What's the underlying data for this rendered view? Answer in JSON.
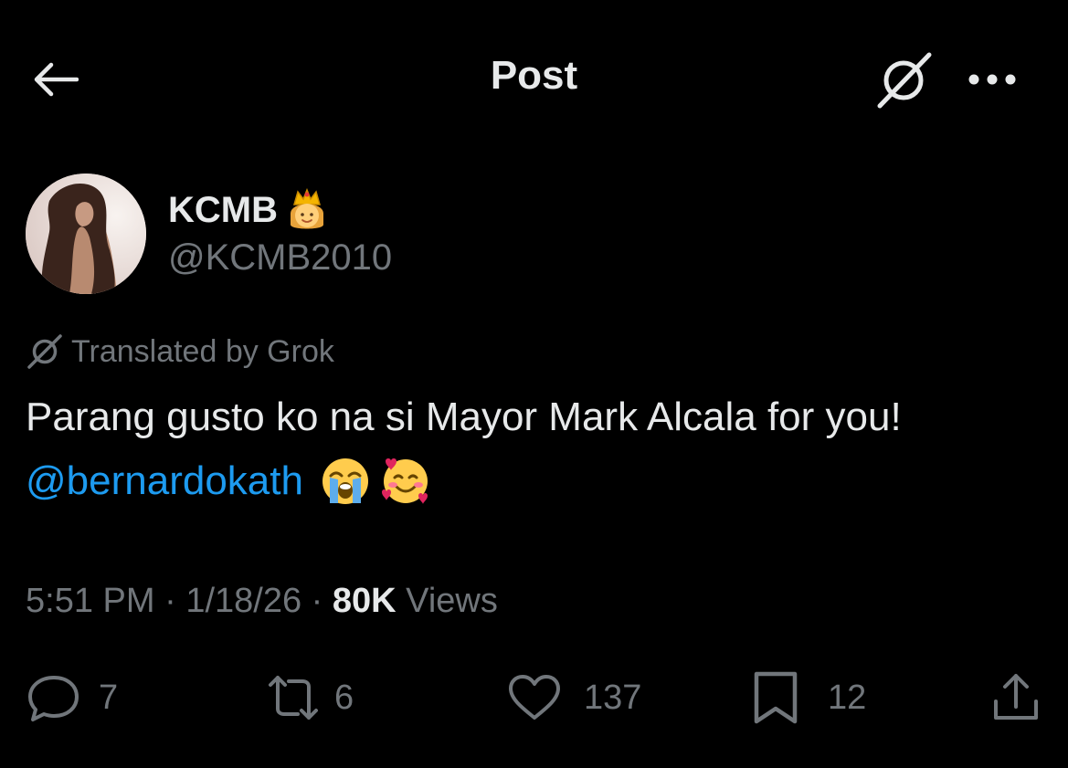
{
  "header": {
    "title": "Post",
    "back_icon": "arrow-left-icon",
    "grok_icon": "grok-icon",
    "more_icon": "more-horizontal-icon"
  },
  "author": {
    "display_name": "KCMB",
    "name_emoji": "princess-emoji",
    "handle": "@KCMB2010"
  },
  "translation": {
    "label": "Translated by Grok",
    "icon": "grok-icon"
  },
  "post": {
    "text": "Parang gusto ko na si Mayor Mark Alcala for you!",
    "mention": "@bernardokath",
    "emojis": [
      "loudly-crying-face-emoji",
      "smiling-face-with-hearts-emoji"
    ]
  },
  "meta": {
    "time": "5:51 PM",
    "separator": "·",
    "date": "1/18/26",
    "views_count": "80K",
    "views_label": "Views"
  },
  "actions": {
    "replies": "7",
    "reposts": "6",
    "likes": "137",
    "bookmarks": "12"
  },
  "colors": {
    "background": "#000000",
    "text_primary": "#e7e9ea",
    "text_secondary": "#71767b",
    "link": "#1d9bf0"
  }
}
